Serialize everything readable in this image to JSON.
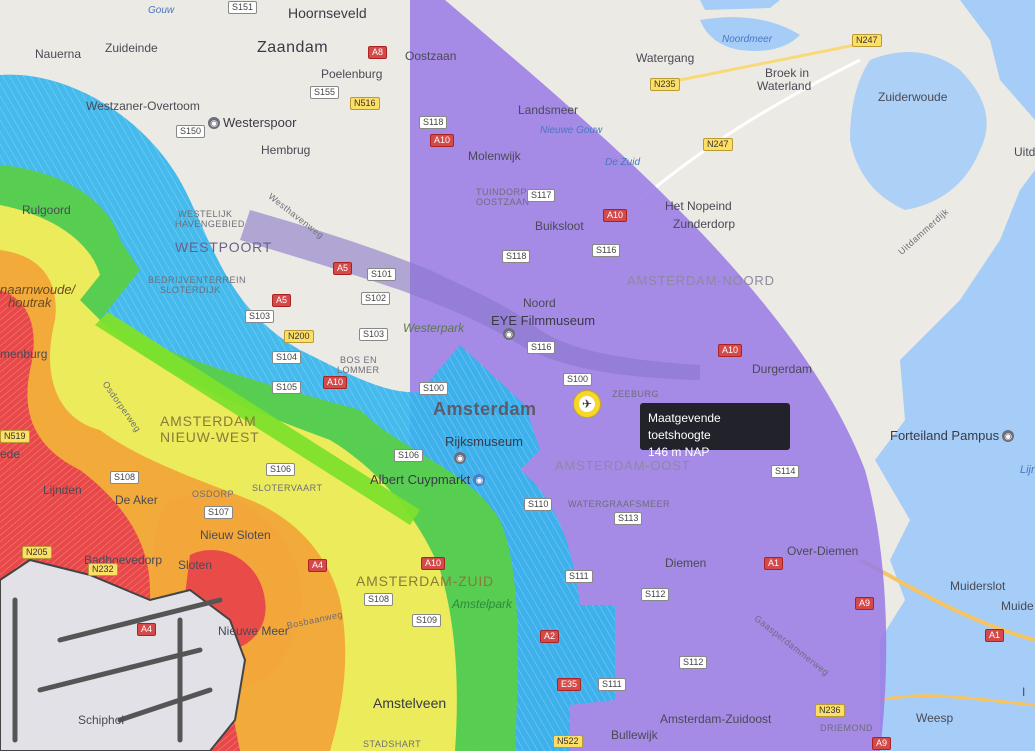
{
  "colors": {
    "purple": "#9b7ce6",
    "blue": "#33b5ec",
    "green": "#59cf44",
    "yellow": "#f3ec5c",
    "orange": "#f2a63a",
    "red": "#e8424a",
    "water": "#a5cdf7",
    "land": "#eceae4"
  },
  "tooltip": {
    "title": "Maatgevende toetshoogte",
    "value": "146 m NAP"
  },
  "marker": {
    "icon": "airport-location-marker-icon"
  },
  "labels": {
    "gouw": "Gouw",
    "hoornseveld": "Hoornseveld",
    "zaandam": "Zaandam",
    "nauerna": "Nauerna",
    "zuideinde": "Zuideinde",
    "oostzaan": "Oostzaan",
    "poelenburg": "Poelenburg",
    "westzaner": "Westzaner-Overtoom",
    "westerspoor": "Westerspoor",
    "hembrug": "Hembrug",
    "landsmeer": "Landsmeer",
    "nieuwe_gouw": "Nieuwe Gouw",
    "molenwijk": "Molenwijk",
    "de_zuid": "De Zuid",
    "noordmeer": "Noordmeer",
    "watergang": "Watergang",
    "broek_in_waterland_1": "Broek in",
    "broek_in_waterland_2": "Waterland",
    "zuiderwoude": "Zuiderwoude",
    "uitd": "Uitd",
    "tuindorp_1": "TUINDORP",
    "tuindorp_2": "OOSTZAAN",
    "het_nopeind": "Het Nopeind",
    "zunderdorp": "Zunderdorp",
    "buiksloot": "Buiksloot",
    "rulgoord": "Rulgoord",
    "westelijk_1": "WESTELIJK",
    "westelijk_2": "HAVENGEBIED",
    "westpoort": "WESTPOORT",
    "westhavenweg": "Westhavenweg",
    "amsterdam_noord": "AMSTERDAM-NOORD",
    "uitdammerdijk": "Uitdammerdijk",
    "bedrijventerrein_1": "BEDRIJVENTERREIN",
    "bedrijventerrein_2": "SLOTERDIJK",
    "haarlemmerhoutrak": "naarnwoude/",
    "houtrak": "houtrak",
    "noord": "Noord",
    "westerpark": "Westerpark",
    "menburg": "menburg",
    "durgerdam": "Durgerdam",
    "amsterdam": "Amsterdam",
    "zeeburg": "ZEEBURG",
    "bos_en_lommer_1": "BOS EN",
    "bos_en_lommer_2": "LOMMER",
    "osdorperweg": "Osdorperweg",
    "amsterdam_nieuw_west_1": "AMSTERDAM",
    "amsterdam_nieuw_west_2": "NIEUW-WEST",
    "forteiland": "Forteiland Pampus",
    "amsterdam_oost": "AMSTERDAM-OOST",
    "lijnden": "Lijnden",
    "de_aker": "De Aker",
    "osdorp": "OSDORP",
    "slotervaart": "SLOTERVAART",
    "lijn": "Lijn",
    "watergraafsmeer": "WATERGRAAFSMEER",
    "ede": "ede",
    "nieuw_sloten": "Nieuw Sloten",
    "over_diemen": "Over-Diemen",
    "diemen": "Diemen",
    "badhoevedorp": "Badhoevedorp",
    "sloten": "Sloten",
    "amsterdam_zuid": "AMSTERDAM-ZUID",
    "amstelpark": "Amstelpark",
    "muiderslot": "Muiderslot",
    "muide": "Muide",
    "nieuwe_meer": "Nieuwe Meer",
    "bosbaanweg": "Bosbaanweg",
    "amstelveen": "Amstelveen",
    "schiphol": "Schiphol",
    "stadshart": "STADSHART",
    "bullewijk": "Bullewijk",
    "amsterdam_zuidoost": "Amsterdam-Zuidoost",
    "driemond": "DRIEMOND",
    "weesp": "Weesp",
    "gaasperdammerweg": "Gaasperdammerweg",
    "i": "I"
  },
  "pois": {
    "westerspoor": "Westerspoor",
    "eye": "EYE Filmmuseum",
    "rijksmuseum": "Rijksmuseum",
    "albert_cuyp": "Albert Cuypmarkt",
    "pampus": "Forteiland Pampus"
  },
  "shields": {
    "s151": "S151",
    "n247a": "N247",
    "a8": "A8",
    "s155": "S155",
    "n516": "N516",
    "n235": "N235",
    "s118a": "S118",
    "a10a": "A10",
    "s150": "S150",
    "n247b": "N247",
    "s117": "S117",
    "a10b": "A10",
    "s118b": "S118",
    "s116a": "S116",
    "a5a": "A5",
    "s101": "S101",
    "s102": "S102",
    "a5b": "A5",
    "s103a": "S103",
    "s103b": "S103",
    "n200": "N200",
    "s116b": "S116",
    "a10c": "A10",
    "s100a": "S100",
    "s104": "S104",
    "s105": "S105",
    "a10d": "A10",
    "s100b": "S100",
    "s106a": "S106",
    "s114": "S114",
    "s106b": "S106",
    "s108": "S108",
    "s107": "S107",
    "s110": "S110",
    "s113": "S113",
    "n232": "N232",
    "a4a": "A4",
    "a10e": "A10",
    "a1a": "A1",
    "s111": "S111",
    "s112a": "S112",
    "a9a": "A9",
    "a2": "A2",
    "s108b": "S108",
    "s109": "S109",
    "a4b": "A4",
    "s112b": "S112",
    "a1b": "A1",
    "e35": "E35",
    "s111b": "S111",
    "n236": "N236",
    "n522": "N522",
    "a9b": "A9",
    "n519": "N519",
    "n205": "N205"
  }
}
